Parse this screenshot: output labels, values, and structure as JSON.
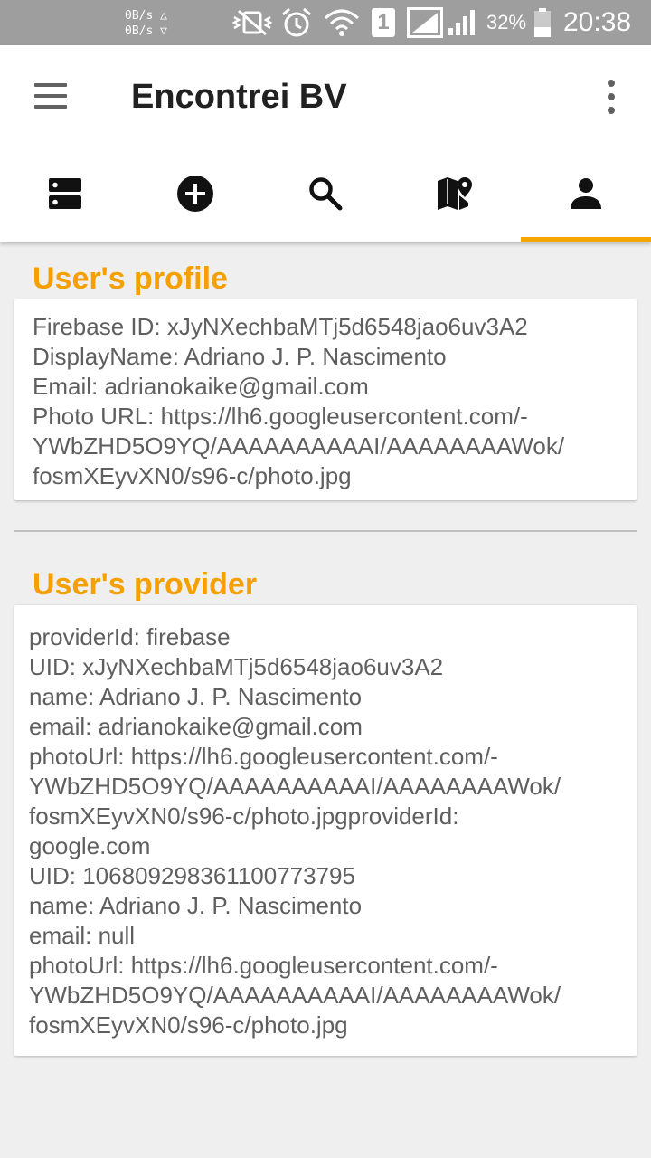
{
  "status_bar": {
    "net_up": "0B/s △",
    "net_down": "0B/s ▽",
    "sim_badge": "1",
    "battery_percent": "32%",
    "time": "20:38"
  },
  "app_bar": {
    "title": "Encontrei BV",
    "tabs": [
      {
        "icon": "list-icon",
        "active": false
      },
      {
        "icon": "add-circle-icon",
        "active": false
      },
      {
        "icon": "search-icon",
        "active": false
      },
      {
        "icon": "map-icon",
        "active": false
      },
      {
        "icon": "person-icon",
        "active": true
      }
    ],
    "accent_color": "#f5a500"
  },
  "profile": {
    "heading": "User's profile",
    "lines": [
      "Firebase ID: xJyNXechbaMTj5d6548jao6uv3A2",
      "DisplayName: Adriano J. P. Nascimento",
      "Email: adrianokaike@gmail.com",
      "Photo URL: https://lh6.googleusercontent.com/-",
      "YWbZHD5O9YQ/AAAAAAAAAAI/AAAAAAAAWok/",
      "fosmXEyvXN0/s96-c/photo.jpg"
    ]
  },
  "provider": {
    "heading": "User's provider",
    "lines": [
      "providerId: firebase",
      "UID: xJyNXechbaMTj5d6548jao6uv3A2",
      "name: Adriano J. P. Nascimento",
      "email: adrianokaike@gmail.com",
      "photoUrl: https://lh6.googleusercontent.com/-",
      "YWbZHD5O9YQ/AAAAAAAAAAI/AAAAAAAAWok/",
      "fosmXEyvXN0/s96-c/photo.jpgproviderId:",
      "google.com",
      "UID: 106809298361100773795",
      "name: Adriano J. P. Nascimento",
      "email: null",
      "photoUrl: https://lh6.googleusercontent.com/-",
      "YWbZHD5O9YQ/AAAAAAAAAAI/AAAAAAAAWok/",
      "fosmXEyvXN0/s96-c/photo.jpg"
    ]
  }
}
